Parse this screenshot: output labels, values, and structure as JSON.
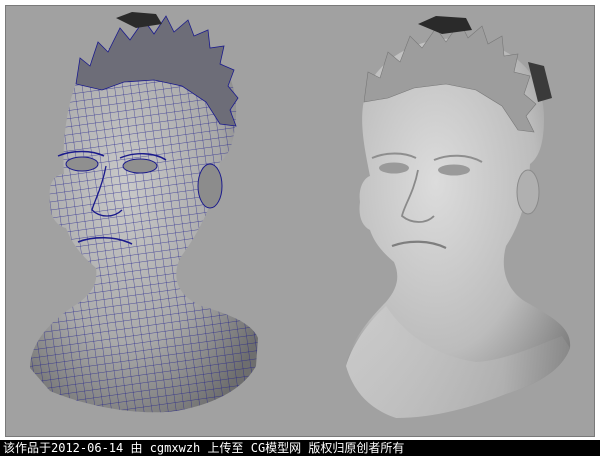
{
  "caption": {
    "text": "该作品于2012-06-14 由 cgmxwzh 上传至 CG模型网  版权归原创者所有"
  },
  "viewport": {
    "background_color": "#a1a1a1",
    "left_model": {
      "render": "wireframe-on-shaded",
      "wire_color": "#1a1a8c"
    },
    "right_model": {
      "render": "smooth-shaded"
    }
  }
}
